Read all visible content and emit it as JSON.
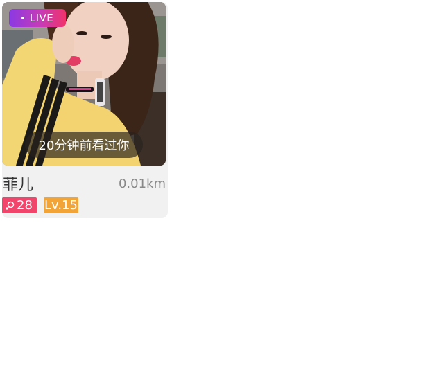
{
  "card": {
    "live_label": "LIVE",
    "seen_text": "20分钟前看过你",
    "name": "菲儿",
    "distance": "0.01km",
    "age": "28",
    "level": "Lv.15"
  },
  "icons": {
    "live_dot": "dot-icon",
    "gender": "female-icon"
  },
  "colors": {
    "live_gradient_start": "#8a3ae3",
    "live_gradient_end": "#f0336a",
    "gender_tag": "#f2456b",
    "level_tag": "#f2a436"
  }
}
